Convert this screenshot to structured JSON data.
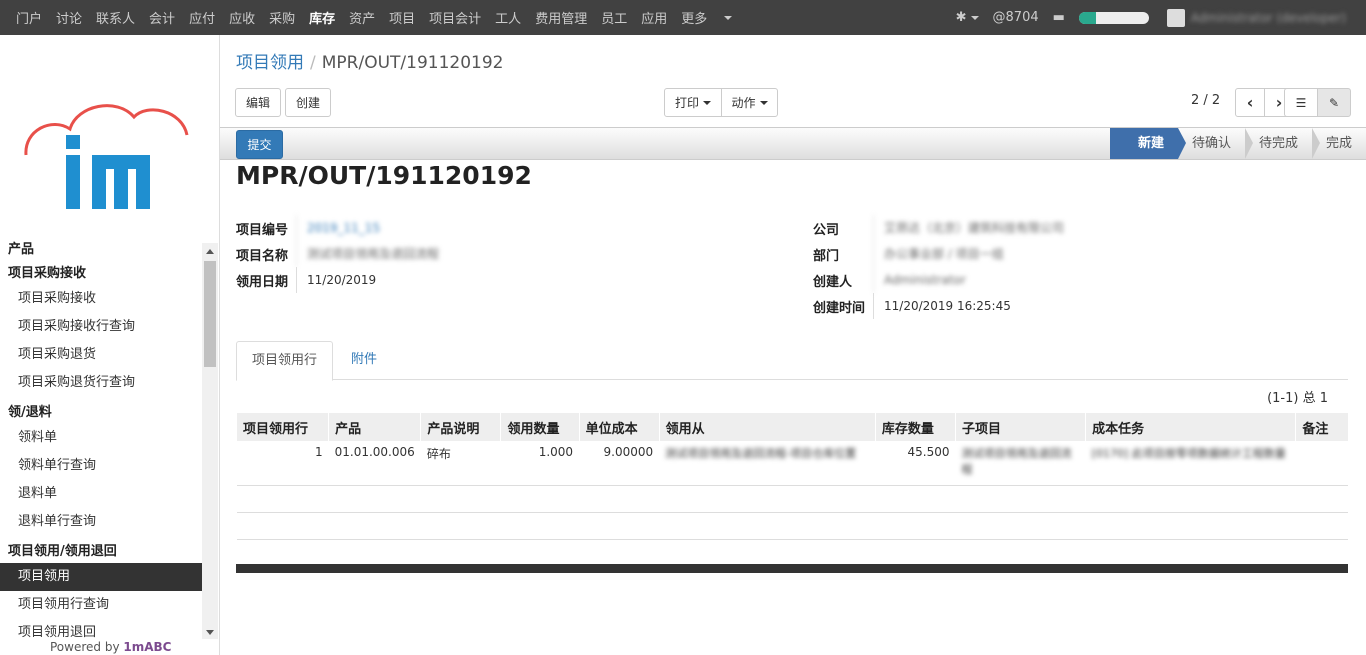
{
  "topnav": {
    "items": [
      "门户",
      "讨论",
      "联系人",
      "会计",
      "应付",
      "应收",
      "采购",
      "库存",
      "资产",
      "项目",
      "项目会计",
      "工人",
      "费用管理",
      "员工",
      "应用",
      "更多"
    ],
    "active_index": 7,
    "messages": "@8704",
    "progress_fraction": 0.25,
    "user": "Administrator (developer)"
  },
  "sidebar": {
    "powered_by_prefix": "Powered by",
    "powered_by_brand": "1mABC",
    "menu": [
      {
        "type": "sec",
        "label": "产品"
      },
      {
        "type": "sec",
        "label": "项目采购接收"
      },
      {
        "type": "item",
        "label": "项目采购接收"
      },
      {
        "type": "item",
        "label": "项目采购接收行查询"
      },
      {
        "type": "item",
        "label": "项目采购退货"
      },
      {
        "type": "item",
        "label": "项目采购退货行查询"
      },
      {
        "type": "sec",
        "label": "领/退料"
      },
      {
        "type": "item",
        "label": "领料单"
      },
      {
        "type": "item",
        "label": "领料单行查询"
      },
      {
        "type": "item",
        "label": "退料单"
      },
      {
        "type": "item",
        "label": "退料单行查询"
      },
      {
        "type": "sec",
        "label": "项目领用/领用退回"
      },
      {
        "type": "item",
        "label": "项目领用",
        "active": true
      },
      {
        "type": "item",
        "label": "项目领用行查询"
      },
      {
        "type": "item",
        "label": "项目领用退回"
      }
    ]
  },
  "breadcrumb": {
    "parent": "项目领用",
    "separator": "/",
    "current": "MPR/OUT/191120192"
  },
  "toolbar": {
    "edit": "编辑",
    "create": "创建",
    "print": "打印",
    "action": "动作",
    "pager": "2 / 2"
  },
  "status": {
    "submit": "提交",
    "stages": [
      "新建",
      "待确认",
      "待完成",
      "完成"
    ],
    "active_stage": 0
  },
  "doc_title": "MPR/OUT/191120192",
  "fields_left": [
    {
      "label": "项目编号",
      "value": "2019_11_15",
      "blur": true,
      "link": true
    },
    {
      "label": "项目名称",
      "value": "测试项目领用及退回流程",
      "blur": true
    },
    {
      "label": "领用日期",
      "value": "11/20/2019"
    }
  ],
  "fields_right": [
    {
      "label": "公司",
      "value": "艾昂达（北京）建筑科技有限公司",
      "blur": true
    },
    {
      "label": "部门",
      "value": "办公事业部 / 项目一组",
      "blur": true
    },
    {
      "label": "创建人",
      "value": "Administrator",
      "blur": true
    },
    {
      "label": "创建时间",
      "value": "11/20/2019 16:25:45"
    }
  ],
  "tabs": {
    "active": "项目领用行",
    "other": "附件"
  },
  "table_count": "(1-1) 总 1",
  "table": {
    "headers": [
      "项目领用行",
      "产品",
      "产品说明",
      "领用数量",
      "单位成本",
      "领用从",
      "库存数量",
      "子项目",
      "成本任务",
      "备注"
    ],
    "rows": [
      {
        "line": "1",
        "product": "01.01.00.006",
        "desc": "碎布",
        "qty": "1.000",
        "unit_cost": "9.00000",
        "from": "测试项目领用及退回流程-项目仓库位置",
        "stock": "45.500",
        "sub_project": "测试项目领用及退回流程",
        "cost_task": "[0170] 此项目按零项数据统计工程数量",
        "note": ""
      }
    ]
  }
}
